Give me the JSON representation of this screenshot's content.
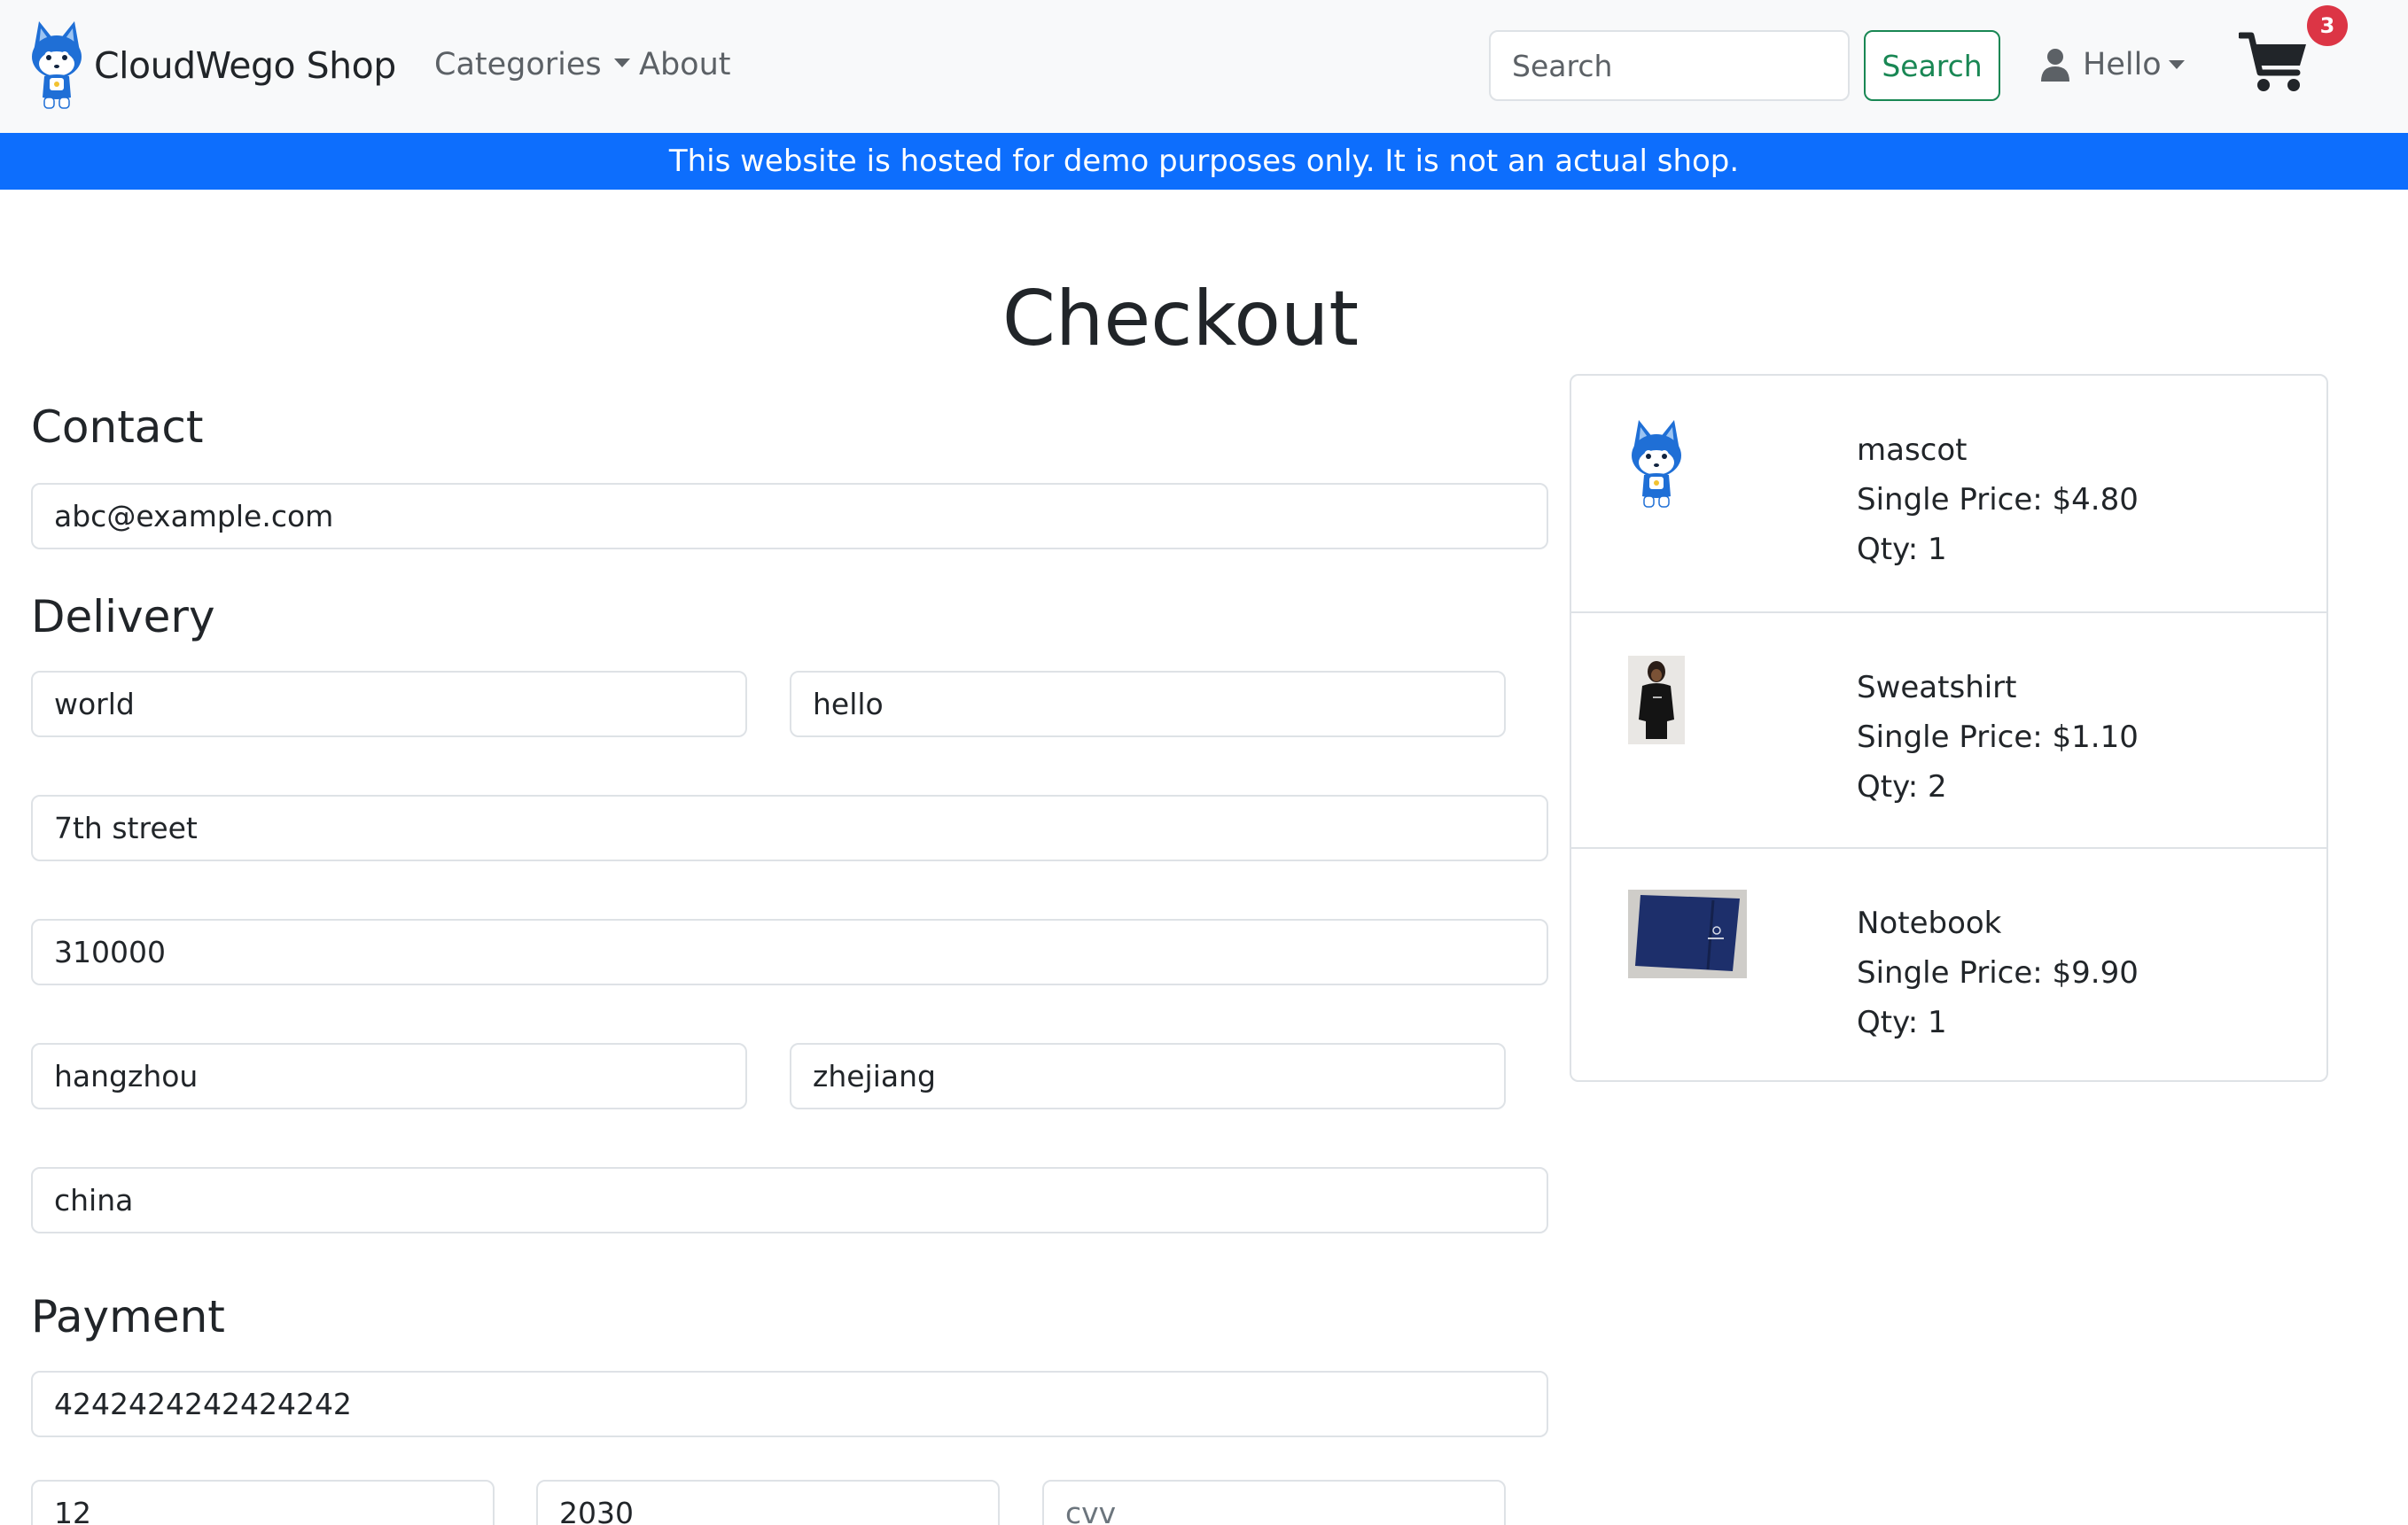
{
  "navbar": {
    "brand_name": "CloudWego Shop",
    "categories_label": "Categories",
    "about_label": "About",
    "search_placeholder": "Search",
    "search_button_label": "Search",
    "user_label": "Hello",
    "cart_count": "3"
  },
  "banner": {
    "text": "This website is hosted for demo purposes only. It is not an actual shop."
  },
  "page": {
    "title": "Checkout"
  },
  "contact": {
    "heading": "Contact",
    "email": "abc@example.com"
  },
  "delivery": {
    "heading": "Delivery",
    "first_name": "world",
    "last_name": "hello",
    "street": "7th street",
    "zip": "310000",
    "city": "hangzhou",
    "province": "zhejiang",
    "country": "china"
  },
  "payment": {
    "heading": "Payment",
    "card_number": "4242424242424242",
    "exp_month": "12",
    "exp_year": "2030",
    "cvv_placeholder": "cvv"
  },
  "cart_items": [
    {
      "name": "mascot",
      "price": "Single Price: $4.80",
      "qty": "Qty: 1"
    },
    {
      "name": "Sweatshirt",
      "price": "Single Price: $1.10",
      "qty": "Qty: 2"
    },
    {
      "name": "Notebook",
      "price": "Single Price: $9.90",
      "qty": "Qty: 1"
    }
  ],
  "colors": {
    "banner": "#0d6efd",
    "search_button": "#198754",
    "cart_badge": "#dc3545",
    "mascot_blue": "#1f6fd6"
  },
  "icons": {
    "brand_logo": "mascot-icon",
    "user": "person-icon",
    "cart": "shopping-cart-icon"
  }
}
